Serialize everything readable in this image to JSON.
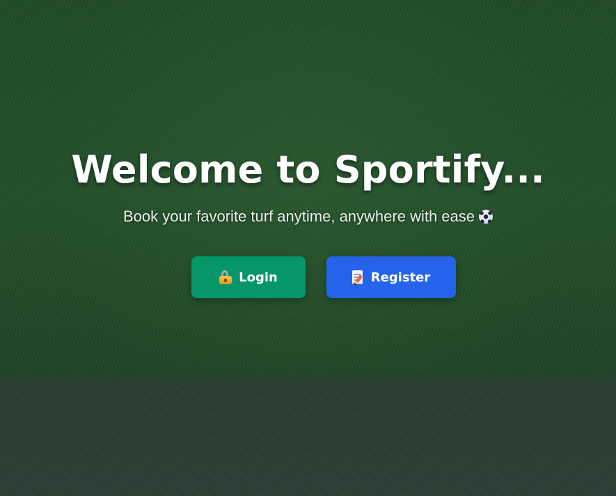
{
  "hero": {
    "title": "Welcome to Sportify...",
    "subtitle": "Book your favorite turf anytime, anywhere with ease",
    "subtitle_icon": "soccer-ball-icon"
  },
  "actions": {
    "login": {
      "label": "Login",
      "icon": "lock-icon",
      "color": "#059669"
    },
    "register": {
      "label": "Register",
      "icon": "memo-icon",
      "color": "#2563eb"
    }
  },
  "background": {
    "image": "grass-turf-background"
  }
}
